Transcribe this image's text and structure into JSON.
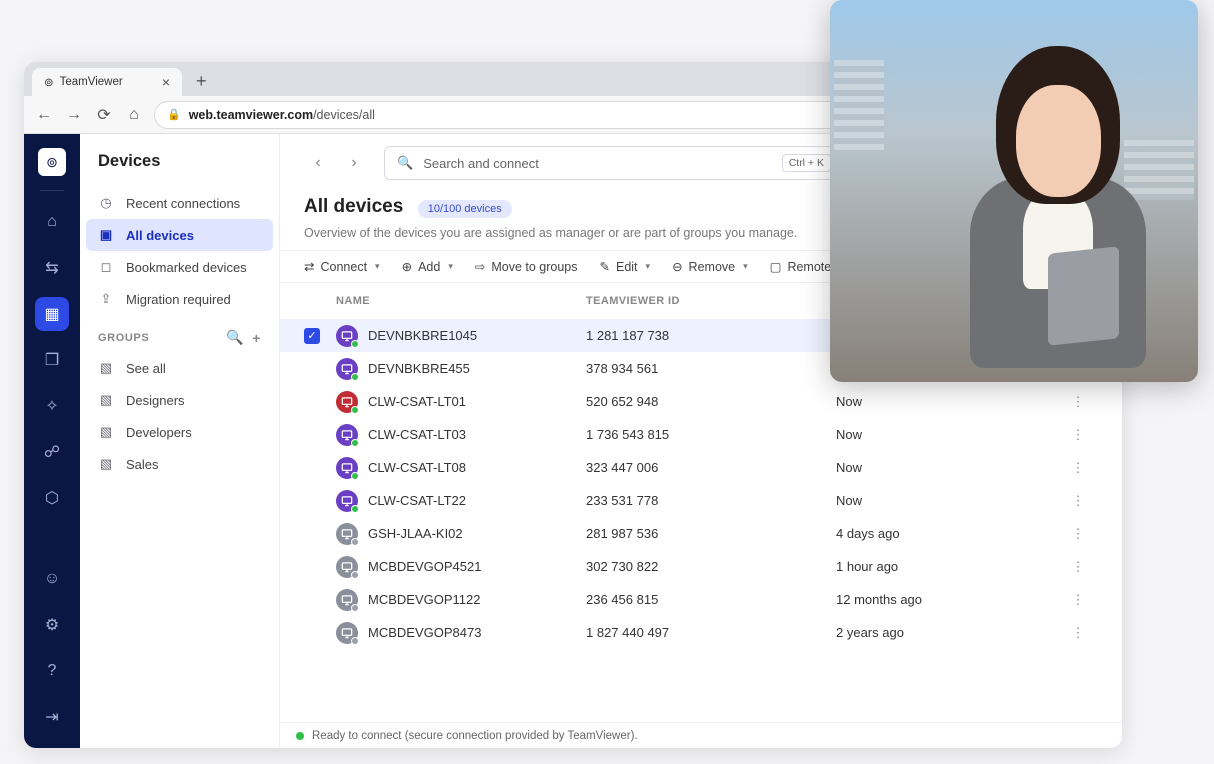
{
  "browser": {
    "tab_label": "TeamViewer",
    "url_host": "web.teamviewer.com",
    "url_path": "/devices/all"
  },
  "sidebar": {
    "title": "Devices",
    "items": [
      {
        "label": "Recent connections",
        "icon": "clock"
      },
      {
        "label": "All devices",
        "icon": "monitor",
        "active": true
      },
      {
        "label": "Bookmarked devices",
        "icon": "bookmark"
      },
      {
        "label": "Migration required",
        "icon": "migrate"
      }
    ],
    "groups_header": "GROUPS",
    "groups": [
      {
        "label": "See all"
      },
      {
        "label": "Designers"
      },
      {
        "label": "Developers"
      },
      {
        "label": "Sales"
      }
    ]
  },
  "header": {
    "search_placeholder": "Search and connect",
    "shortcut": "Ctrl + K",
    "title": "All devices",
    "badge": "10/100 devices",
    "subtitle": "Overview of the devices you are assigned as manager or are part of groups you manage."
  },
  "toolbar": {
    "connect": "Connect",
    "add": "Add",
    "move": "Move to groups",
    "edit": "Edit",
    "remove": "Remove",
    "remote": "Remote management"
  },
  "table": {
    "columns": {
      "name": "NAME",
      "id": "TEAMVIEWER ID",
      "last": ""
    },
    "rows": [
      {
        "name": "DEVNBKBRE1045",
        "id": "1 281 187 738",
        "last": "",
        "icon": "purple",
        "online": true,
        "selected": true
      },
      {
        "name": "DEVNBKBRE455",
        "id": "378 934 561",
        "last": "",
        "icon": "purple",
        "online": true
      },
      {
        "name": "CLW-CSAT-LT01",
        "id": "520 652 948",
        "last": "Now",
        "icon": "red",
        "online": true
      },
      {
        "name": "CLW-CSAT-LT03",
        "id": "1 736 543 815",
        "last": "Now",
        "icon": "purple",
        "online": true
      },
      {
        "name": "CLW-CSAT-LT08",
        "id": "323 447 006",
        "last": "Now",
        "icon": "purple",
        "online": true
      },
      {
        "name": "CLW-CSAT-LT22",
        "id": "233 531 778",
        "last": "Now",
        "icon": "purple",
        "online": true
      },
      {
        "name": "GSH-JLAA-KI02",
        "id": "281 987 536",
        "last": "4 days ago",
        "icon": "grey",
        "online": false
      },
      {
        "name": "MCBDEVGOP4521",
        "id": "302 730 822",
        "last": "1 hour ago",
        "icon": "grey",
        "online": false
      },
      {
        "name": "MCBDEVGOP1122",
        "id": "236 456 815",
        "last": "12 months ago",
        "icon": "grey",
        "online": false
      },
      {
        "name": "MCBDEVGOP8473",
        "id": "1 827 440 497",
        "last": "2 years ago",
        "icon": "grey",
        "online": false
      }
    ]
  },
  "status_bar": "Ready to connect (secure connection provided by TeamViewer)."
}
